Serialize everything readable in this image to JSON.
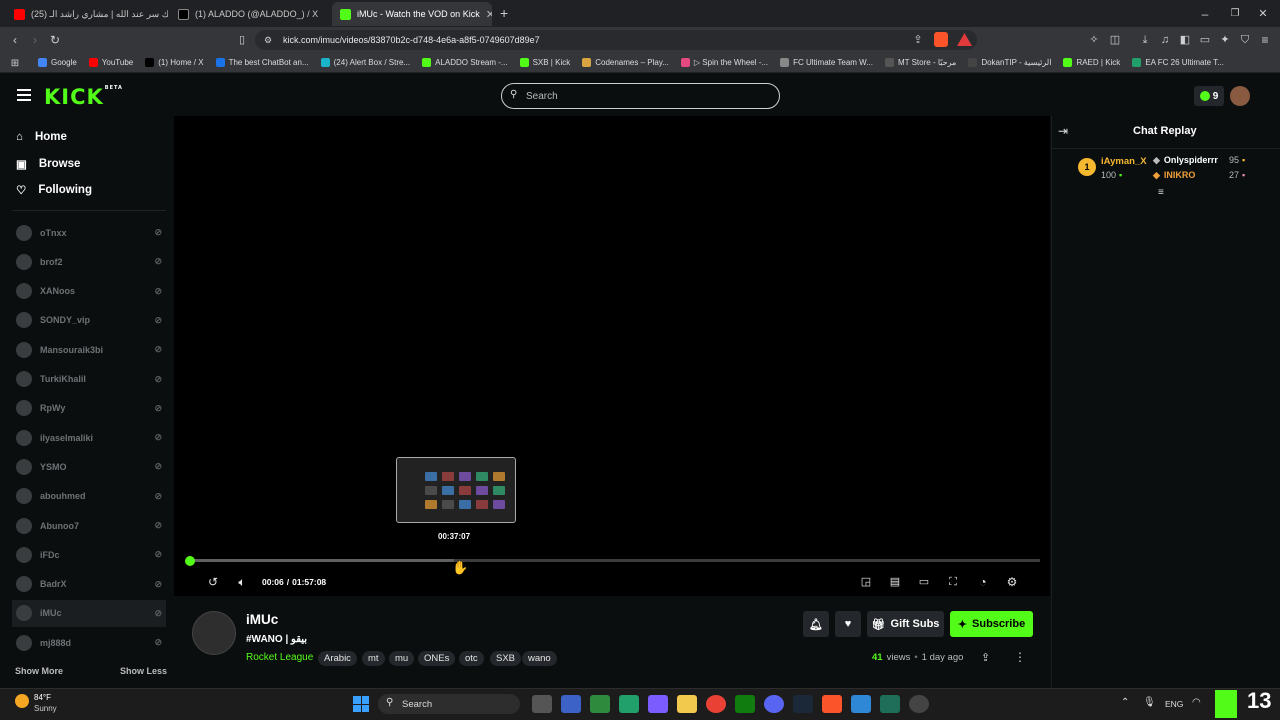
{
  "browser": {
    "tabs": [
      {
        "title": "(25) هل لك سر عند الله | مشاري راشد الـ",
        "color": "#ff0000"
      },
      {
        "title": "(1) ALADDO (@ALADDO_) / X",
        "color": "#000000"
      },
      {
        "title": "iMUc - Watch the VOD on Kick",
        "color": "#53fc18"
      }
    ],
    "new_tab": "+",
    "url": "kick.com/imuc/videos/83870b2c-d748-4e6a-a8f5-0749607d89e7",
    "bookmarks": [
      "Google",
      "YouTube",
      "(1) Home / X",
      "The best ChatBot an...",
      "(24) Alert Box / Stre...",
      "ALADDO Stream -...",
      "SXB | Kick",
      "Codenames – Play...",
      "▷ Spin the Wheel -...",
      "FC Ultimate Team W...",
      "MT Store - مرحبًا",
      "DokanTIP - الرئيسية",
      "RAED | Kick",
      "EA FC 26 Ultimate T..."
    ]
  },
  "kick": {
    "logo": "KICK",
    "logo_badge": "BETA",
    "search_placeholder": "Search",
    "points": "9",
    "nav": [
      {
        "label": "Home",
        "icon": "home-icon",
        "glyph": "⌂"
      },
      {
        "label": "Browse",
        "icon": "browse-icon",
        "glyph": "▣"
      },
      {
        "label": "Following",
        "icon": "heart-icon",
        "glyph": "♡"
      }
    ],
    "channels": [
      "oTnxx",
      "brof2",
      "XANoos",
      "SONDY_vip",
      "Mansouraik3bi",
      "TurkiKhalil",
      "RpWy",
      "ilyaselmaliki",
      "YSMO",
      "abouhmed",
      "Abunoo7",
      "iFDc",
      "BadrX",
      "iMUc",
      "mj888d"
    ],
    "show_more": "Show More",
    "show_less": "Show Less",
    "player": {
      "preview_time": "00:37:07",
      "current_time": "00:06",
      "duration": "01:57:08",
      "time_separator": "/",
      "buffered_fraction": 0.31
    },
    "stream": {
      "channel": "iMUc",
      "title": "#WANO | بيقو",
      "category": "Rocket League",
      "tags": [
        "Arabic",
        "mt",
        "mu",
        "ONEs",
        "otc",
        "SXB",
        "wano"
      ],
      "views_count": "41",
      "views_label": "views",
      "age": "1 day ago",
      "gift_label": "Gift Subs",
      "subscribe_label": "Subscribe"
    },
    "chat": {
      "title": "Chat Replay",
      "leaderboard": {
        "rank": "1",
        "top_user": "iAyman_X",
        "top_value": "100",
        "entries": [
          {
            "user": "Onlyspiderrr",
            "value": "95"
          },
          {
            "user": "INIKRO",
            "value": "27"
          }
        ]
      }
    }
  },
  "taskbar": {
    "weather_temp": "84°F",
    "weather_desc": "Sunny",
    "search_label": "Search",
    "lang": "ENG",
    "overlay_number": "13"
  },
  "colors": {
    "accent": "#53fc18",
    "page_bg": "#0b0e0f",
    "leader_gold": "#f5b82e",
    "leader_orange": "#f0a13c"
  }
}
